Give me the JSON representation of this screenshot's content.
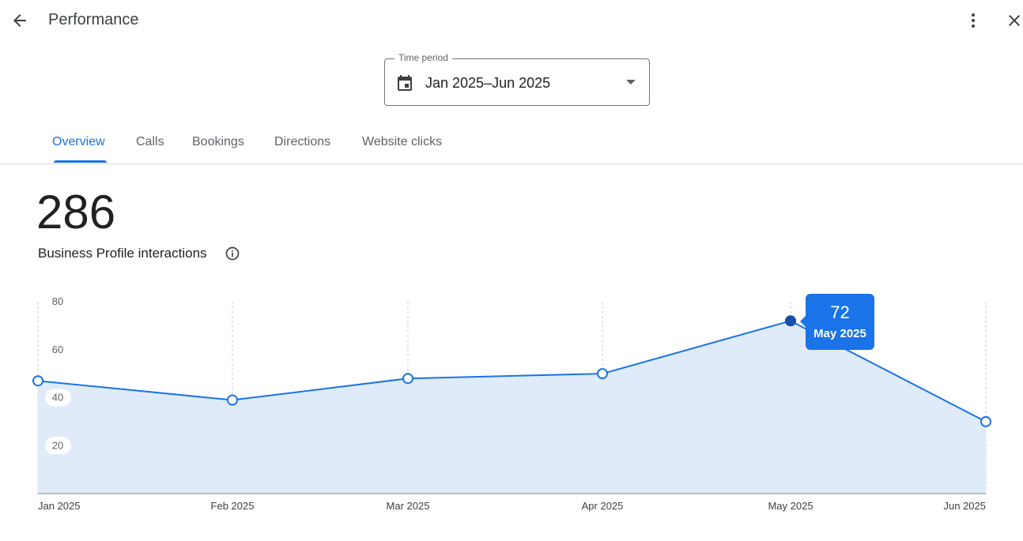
{
  "header": {
    "title": "Performance",
    "back_icon": "arrow-back-icon",
    "more_icon": "more-vert-icon",
    "close_icon": "close-icon"
  },
  "time_period": {
    "legend": "Time period",
    "value": "Jan 2025–Jun 2025",
    "icon": "calendar-icon"
  },
  "tabs": [
    {
      "label": "Overview",
      "active": true
    },
    {
      "label": "Calls",
      "active": false
    },
    {
      "label": "Bookings",
      "active": false
    },
    {
      "label": "Directions",
      "active": false
    },
    {
      "label": "Website clicks",
      "active": false
    }
  ],
  "summary": {
    "value": "286",
    "label": "Business Profile interactions",
    "info_icon": "info-icon"
  },
  "tooltip": {
    "value": "72",
    "label": "May 2025"
  },
  "colors": {
    "accent": "#1a73e8",
    "fill": "#e0ebfa",
    "highlight_point": "#174ea6"
  },
  "chart_data": {
    "type": "area",
    "categories": [
      "Jan 2025",
      "Feb 2025",
      "Mar 2025",
      "Apr 2025",
      "May 2025",
      "Jun 2025"
    ],
    "values": [
      47,
      39,
      48,
      50,
      72,
      30
    ],
    "yticks": [
      20,
      40,
      60,
      80
    ],
    "ylim": [
      0,
      80
    ],
    "grid": "vertical dashed",
    "highlighted_index": 4
  }
}
